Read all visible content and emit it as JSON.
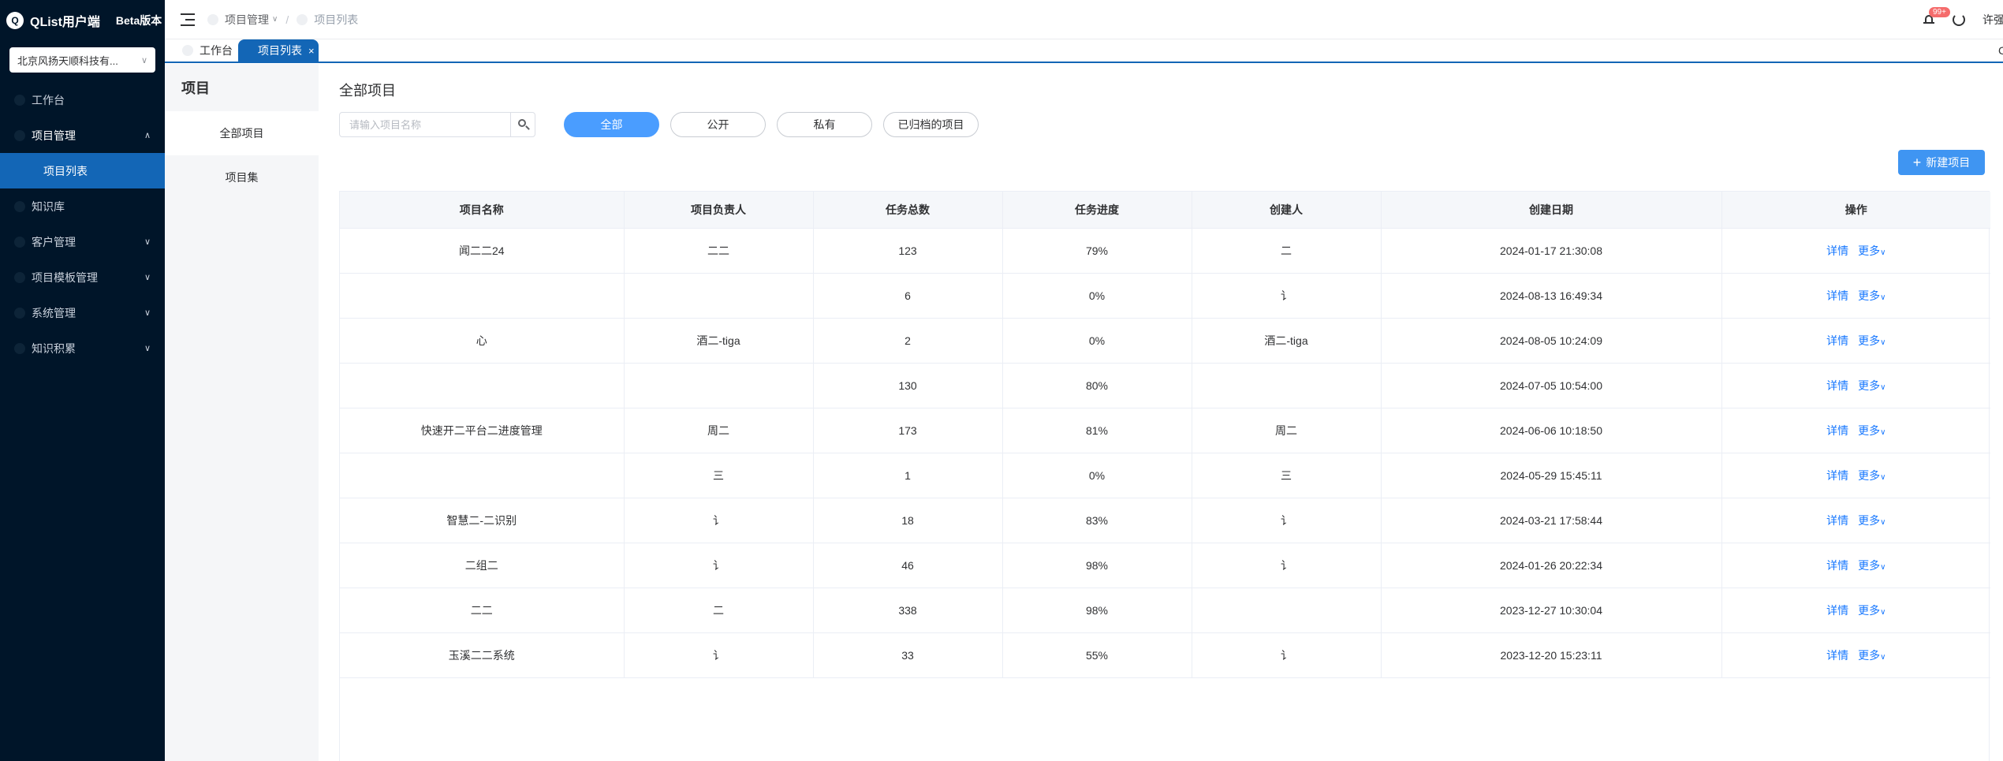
{
  "brand": {
    "logo_text": "Q",
    "name": "QList用户端",
    "edition": "Beta版本"
  },
  "org_selector": {
    "value": "北京风扬天顺科技有..."
  },
  "sidebar": {
    "items": [
      {
        "label": "工作台"
      },
      {
        "label": "项目管理",
        "expanded": true
      },
      {
        "label": "项目列表",
        "sub": true,
        "active": true
      },
      {
        "label": "知识库"
      },
      {
        "label": "客户管理",
        "expandable": true
      },
      {
        "label": "项目模板管理",
        "expandable": true
      },
      {
        "label": "系统管理",
        "expandable": true
      },
      {
        "label": "知识积累",
        "expandable": true
      }
    ]
  },
  "header": {
    "breadcrumb": [
      "项目管理",
      "项目列表"
    ],
    "notification_badge": "99+",
    "user_name": "许强"
  },
  "tabs": {
    "home": "工作台",
    "active": "项目列表",
    "close_glyph": "×"
  },
  "subnav": {
    "title": "项目",
    "items": [
      "全部项目",
      "项目集"
    ]
  },
  "main": {
    "title": "全部项目",
    "search_placeholder": "请输入项目名称",
    "filters": [
      "全部",
      "公开",
      "私有",
      "已归档的项目"
    ],
    "active_filter": "全部",
    "new_button": "新建项目",
    "columns": [
      "项目名称",
      "项目负责人",
      "任务总数",
      "任务进度",
      "创建人",
      "创建日期",
      "操作"
    ],
    "row_actions": {
      "detail": "详情",
      "more": "更多"
    },
    "rows": [
      {
        "name": "闻二二24",
        "owner": "二二",
        "total": "123",
        "progress": "79%",
        "creator": "二",
        "date": "2024-01-17 21:30:08"
      },
      {
        "name": "",
        "owner": "",
        "total": "6",
        "progress": "0%",
        "creator": "讠",
        "date": "2024-08-13 16:49:34"
      },
      {
        "name": "心",
        "owner": "酒二-tiga",
        "total": "2",
        "progress": "0%",
        "creator": "酒二-tiga",
        "date": "2024-08-05 10:24:09"
      },
      {
        "name": "",
        "owner": "",
        "total": "130",
        "progress": "80%",
        "creator": "",
        "date": "2024-07-05 10:54:00"
      },
      {
        "name": "快速开二平台二进度管理",
        "owner": "周二",
        "total": "173",
        "progress": "81%",
        "creator": "周二",
        "date": "2024-06-06 10:18:50"
      },
      {
        "name": "",
        "owner": "三",
        "total": "1",
        "progress": "0%",
        "creator": "三",
        "date": "2024-05-29 15:45:11"
      },
      {
        "name": "智慧二-二识别",
        "owner": "讠",
        "total": "18",
        "progress": "83%",
        "creator": "讠",
        "date": "2024-03-21 17:58:44"
      },
      {
        "name": "二组二",
        "owner": "讠",
        "total": "46",
        "progress": "98%",
        "creator": "讠",
        "date": "2024-01-26 20:22:34"
      },
      {
        "name": "二二",
        "owner": "二",
        "total": "338",
        "progress": "98%",
        "creator": "",
        "date": "2023-12-27 10:30:04"
      },
      {
        "name": "玉溪二二系统",
        "owner": "讠",
        "total": "33",
        "progress": "55%",
        "creator": "讠",
        "date": "2023-12-20 15:23:11"
      }
    ]
  }
}
